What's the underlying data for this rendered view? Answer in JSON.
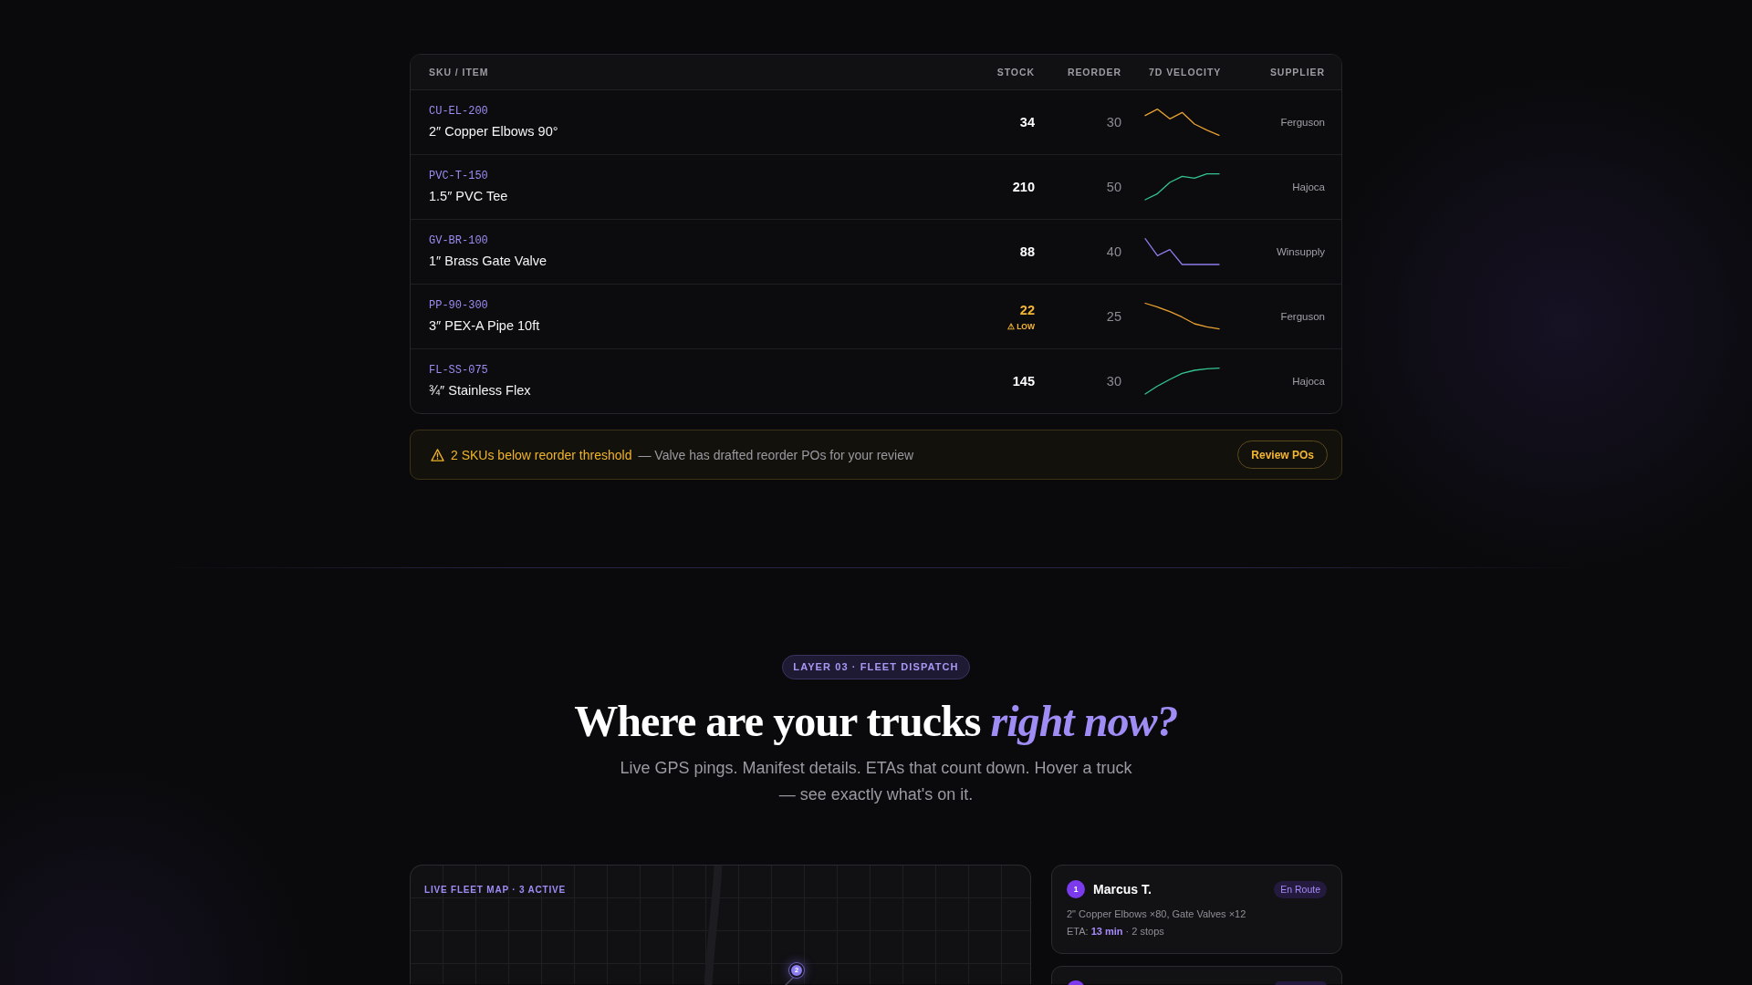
{
  "inventory_table": {
    "columns": [
      "SKU / ITEM",
      "STOCK",
      "REORDER",
      "7D VELOCITY",
      "SUPPLIER"
    ],
    "rows": [
      {
        "sku": "CU-EL-200",
        "item": "2″ Copper Elbows 90°",
        "stock": "34",
        "low": false,
        "reorder": "30",
        "color": "#e8a030",
        "supplier": "Ferguson"
      },
      {
        "sku": "PVC-T-150",
        "item": "1.5″ PVC Tee",
        "stock": "210",
        "low": false,
        "reorder": "50",
        "color": "#34c48f",
        "supplier": "Hajoca"
      },
      {
        "sku": "GV-BR-100",
        "item": "1″ Brass Gate Valve",
        "stock": "88",
        "low": false,
        "reorder": "40",
        "color": "#8b7ce8",
        "supplier": "Winsupply"
      },
      {
        "sku": "PP-90-300",
        "item": "3″ PEX-A Pipe 10ft",
        "stock": "22",
        "low": true,
        "low_label": "⚠ LOW",
        "reorder": "25",
        "color": "#e8a030",
        "supplier": "Ferguson"
      },
      {
        "sku": "FL-SS-075",
        "item": "¾″ Stainless Flex",
        "stock": "145",
        "low": false,
        "reorder": "30",
        "color": "#34c48f",
        "supplier": "Hajoca"
      }
    ]
  },
  "reorder_alert": {
    "headline": "2 SKUs below reorder threshold",
    "detail": "— Valve has drafted reorder POs for your review",
    "button": "Review POs"
  },
  "section": {
    "badge": "LAYER 03 · FLEET DISPATCH",
    "heading": "Where are your trucks *right now?*",
    "subtitle": "Live GPS pings. Manifest details. ETAs that count down. Hover a truck — see exactly what's on it."
  },
  "fleet_map": {
    "label": "LIVE FLEET MAP · 3 ACTIVE",
    "trucks": [
      {
        "label": "2"
      }
    ]
  },
  "drivers": [
    {
      "kind": "full",
      "number": "1",
      "name": "Marcus T.",
      "status": "En Route",
      "manifest": "2\" Copper Elbows ×80, Gate Valves ×12",
      "eta": "ETA: **13 min** · 2 stops"
    },
    {
      "kind": "clipped"
    }
  ]
}
